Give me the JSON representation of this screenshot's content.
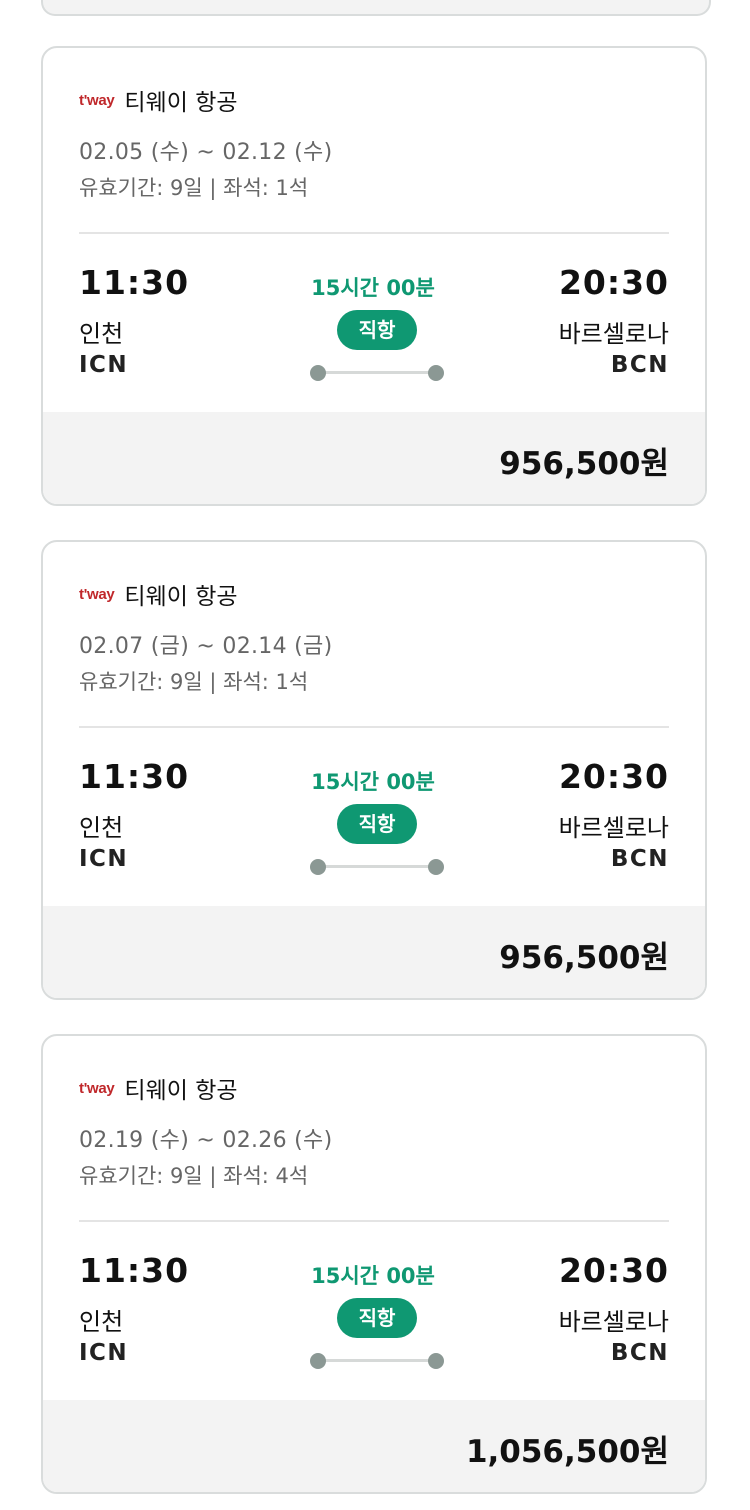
{
  "flights": [
    {
      "airline_logo": "t'way",
      "airline_name": "티웨이 항공",
      "date_range": "02.05 (수) ~ 02.12 (수)",
      "validity": "유효기간: 9일 | 좌석: 1석",
      "departure_time": "11:30",
      "departure_city": "인천",
      "departure_code": "ICN",
      "arrival_time": "20:30",
      "arrival_city": "바르셀로나",
      "arrival_code": "BCN",
      "duration": "15시간 00분",
      "direct_label": "직항",
      "price": "956,500원"
    },
    {
      "airline_logo": "t'way",
      "airline_name": "티웨이 항공",
      "date_range": "02.07 (금) ~ 02.14 (금)",
      "validity": "유효기간: 9일 | 좌석: 1석",
      "departure_time": "11:30",
      "departure_city": "인천",
      "departure_code": "ICN",
      "arrival_time": "20:30",
      "arrival_city": "바르셀로나",
      "arrival_code": "BCN",
      "duration": "15시간 00분",
      "direct_label": "직항",
      "price": "956,500원"
    },
    {
      "airline_logo": "t'way",
      "airline_name": "티웨이 항공",
      "date_range": "02.19 (수) ~ 02.26 (수)",
      "validity": "유효기간: 9일 | 좌석: 4석",
      "departure_time": "11:30",
      "departure_city": "인천",
      "departure_code": "ICN",
      "arrival_time": "20:30",
      "arrival_city": "바르셀로나",
      "arrival_code": "BCN",
      "duration": "15시간 00분",
      "direct_label": "직항",
      "price": "1,056,500원"
    }
  ],
  "colors": {
    "accent_green": "#0f9872",
    "logo_red": "#c0282b",
    "price_bg": "#f3f3f3",
    "border": "#d9dcdc"
  },
  "icons": {
    "route_dots": "route-line-icon"
  }
}
